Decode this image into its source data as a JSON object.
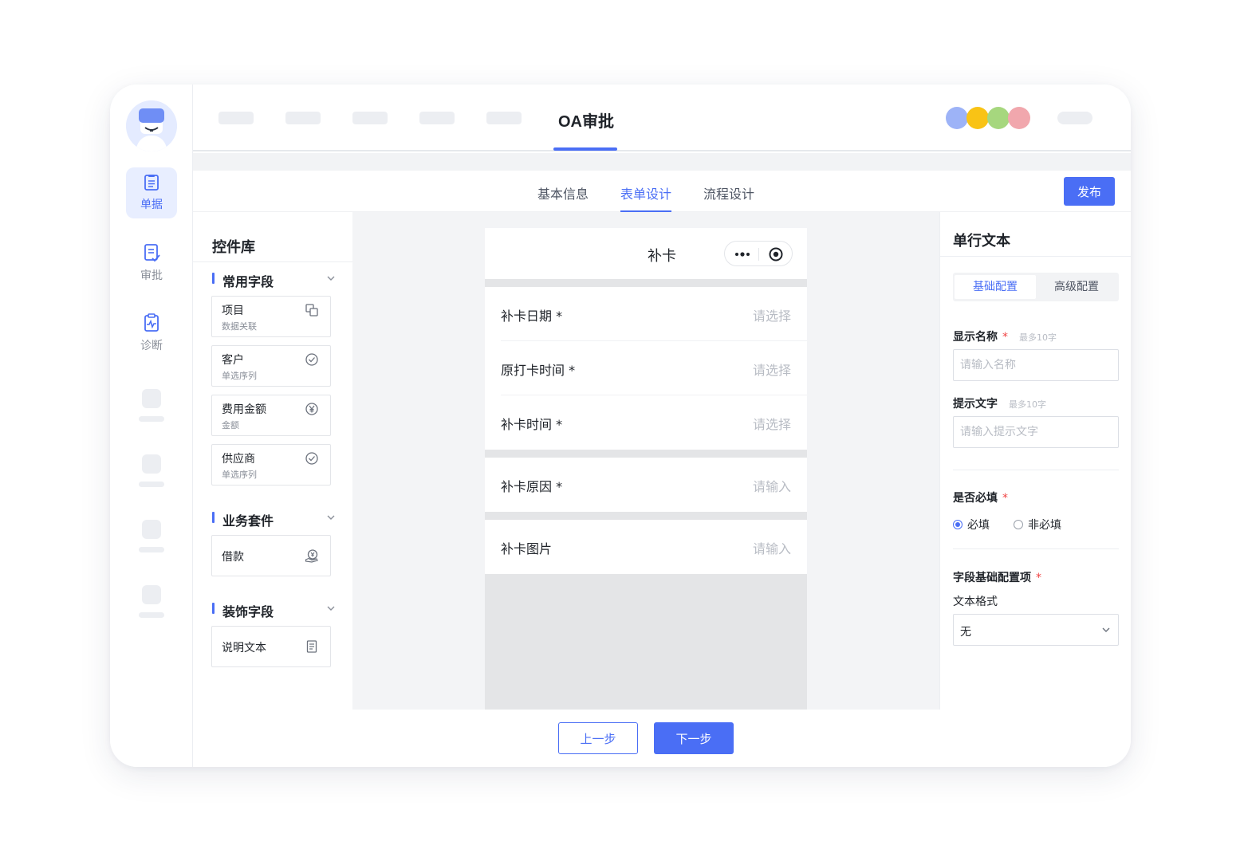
{
  "app": {
    "title": "OA审批"
  },
  "rail": {
    "items": [
      {
        "label": "单据",
        "icon": "document-list-icon",
        "active": true
      },
      {
        "label": "审批",
        "icon": "approval-icon",
        "active": false
      },
      {
        "label": "诊断",
        "icon": "diagnosis-icon",
        "active": false
      }
    ]
  },
  "header": {
    "user_dot_colors": [
      "#9db3f7",
      "#f9c315",
      "#a6d77e",
      "#f1a7ad"
    ]
  },
  "tabs": [
    {
      "label": "基本信息",
      "active": false
    },
    {
      "label": "表单设计",
      "active": true
    },
    {
      "label": "流程设计",
      "active": false
    }
  ],
  "toolbar": {
    "publish_label": "发布"
  },
  "library": {
    "title": "控件库",
    "groups": [
      {
        "title": "常用字段",
        "items": [
          {
            "title": "项目",
            "subtitle": "数据关联",
            "icon": "link-copy-icon"
          },
          {
            "title": "客户",
            "subtitle": "单选序列",
            "icon": "check-circle-icon"
          },
          {
            "title": "费用金额",
            "subtitle": "金额",
            "icon": "yuan-icon"
          },
          {
            "title": "供应商",
            "subtitle": "单选序列",
            "icon": "check-circle-icon"
          }
        ]
      },
      {
        "title": "业务套件",
        "items": [
          {
            "title": "借款",
            "icon": "loan-icon"
          }
        ]
      },
      {
        "title": "装饰字段",
        "items": [
          {
            "title": "说明文本",
            "icon": "text-doc-icon"
          }
        ]
      }
    ]
  },
  "form": {
    "title": "补卡",
    "fields": [
      {
        "label": "补卡日期 *",
        "placeholder": "请选择"
      },
      {
        "label": "原打卡时间 *",
        "placeholder": "请选择"
      },
      {
        "label": "补卡时间 *",
        "placeholder": "请选择"
      },
      {
        "label": "补卡原因 *",
        "placeholder": "请输入"
      },
      {
        "label": "补卡图片",
        "placeholder": "请输入"
      }
    ]
  },
  "config": {
    "title": "单行文本",
    "segments": [
      "基础配置",
      "高级配置"
    ],
    "display_name": {
      "label": "显示名称",
      "required_mark": "*",
      "hint": "最多10字",
      "placeholder": "请输入名称"
    },
    "hint_text": {
      "label": "提示文字",
      "hint": "最多10字",
      "placeholder": "请输入提示文字"
    },
    "required": {
      "label": "是否必填",
      "required_mark": "*",
      "options": [
        "必填",
        "非必填"
      ],
      "selected": "必填"
    },
    "field_basic": {
      "label": "字段基础配置项",
      "required_mark": "*",
      "format_label": "文本格式",
      "format_value": "无"
    }
  },
  "footer": {
    "prev_label": "上一步",
    "next_label": "下一步"
  },
  "colors": {
    "accent": "#4a6ef5"
  }
}
